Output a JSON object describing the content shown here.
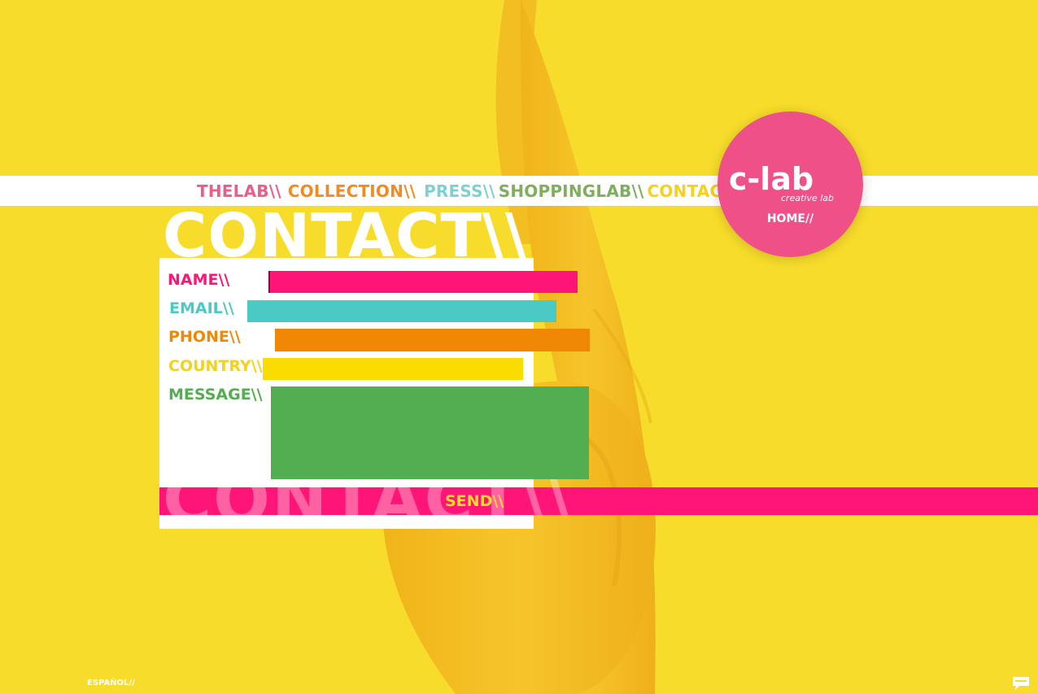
{
  "nav": {
    "items": [
      {
        "label": "THELAB\\\\",
        "color": "#ea5e88"
      },
      {
        "label": "COLLECTION\\\\",
        "color": "#f18c24"
      },
      {
        "label": "PRESS\\\\",
        "color": "#7fd0d2"
      },
      {
        "label": "SHOPPINGLAB\\\\",
        "color": "#7fae5c"
      },
      {
        "label": "CONTACT\\\\",
        "color": "#f5d11b"
      }
    ]
  },
  "logo": {
    "brand": "c-lab",
    "tagline": "creative lab",
    "home_label": "HOME//",
    "circle_color": "#ef5088"
  },
  "page": {
    "heading": "CONTACT\\\\",
    "ghost_heading": "CONTACT\\\\"
  },
  "form": {
    "fields": [
      {
        "label": "NAME\\\\",
        "value": "",
        "color": "#ff1477"
      },
      {
        "label": "EMAIL\\\\",
        "value": "",
        "color": "#4ac9c5"
      },
      {
        "label": "PHONE\\\\",
        "value": "",
        "color": "#f18805"
      },
      {
        "label": "COUNTRY\\\\",
        "value": "",
        "color": "#fadc00"
      },
      {
        "label": "MESSAGE\\\\",
        "value": "",
        "color": "#53ae52"
      }
    ],
    "send_label": "SEND\\\\",
    "send_bar_color": "#ff1477"
  },
  "footer": {
    "language_link": "ESPAÑOL//",
    "chat_icon": "speech-bubble-icon"
  },
  "colors": {
    "background": "#f7dc2b",
    "bag": "#f2b71c"
  }
}
